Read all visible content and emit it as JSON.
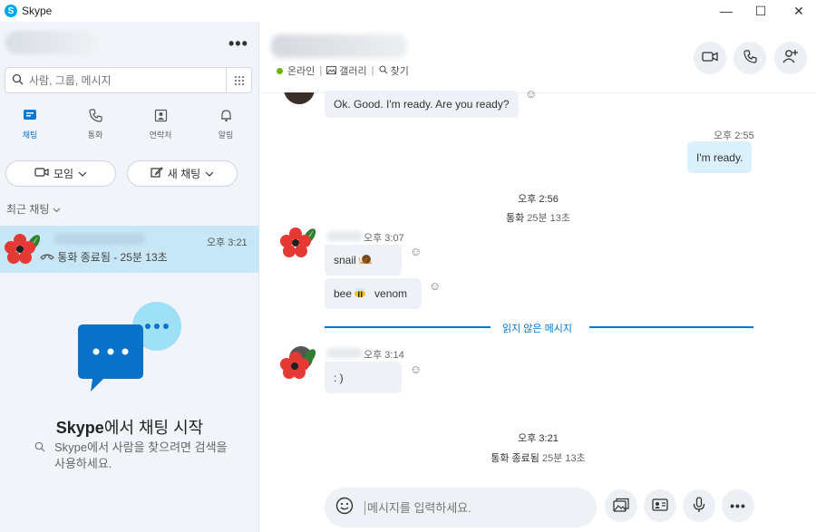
{
  "app": {
    "title": "Skype",
    "icon": "skype-logo-icon"
  },
  "window": {
    "minimize": "—",
    "maximize": "☐",
    "close": "✕"
  },
  "sidebar": {
    "more": "•••",
    "search_placeholder": "사람, 그룹, 메시지",
    "tabs": [
      {
        "label": "채팅",
        "icon": "chat-icon"
      },
      {
        "label": "통화",
        "icon": "phone-icon"
      },
      {
        "label": "연락처",
        "icon": "contacts-icon"
      },
      {
        "label": "알림",
        "icon": "bell-icon"
      }
    ],
    "meet_button": "모임",
    "new_chat_button": "새 채팅",
    "recent_label": "최근 채팅",
    "chat_item": {
      "time": "오후 3:21",
      "preview": "통화 종료됨 - 25분 13초"
    },
    "empty_title_brand": "Skype",
    "empty_title_rest": "에서 채팅 시작",
    "empty_desc": "Skype에서 사람을 찾으려면 검색을 사용하세요.",
    "accent": "#0078d4"
  },
  "header": {
    "status": "온라인",
    "gallery": "갤러리",
    "find": "찾기"
  },
  "messages": {
    "m1": "Ok. Good. I'm ready. Are you ready?",
    "t_me": "오후 2:55",
    "m2": "I'm ready.",
    "sys1_time": "오후 2:56",
    "sys1_label": "통화",
    "sys1_dur": "25분 13초",
    "t_a": "오후 3:07",
    "m3": "snail",
    "m4_a": "bee",
    "m4_b": "venom",
    "unread": "읽지 않은 메시지",
    "t_b": "오후 3:14",
    "m5": ": )",
    "sys2_time": "오후 3:21",
    "sys2_label": "통화 종료됨",
    "sys2_dur": "25분 13초"
  },
  "composer": {
    "placeholder": "메시지를 입력하세요."
  }
}
